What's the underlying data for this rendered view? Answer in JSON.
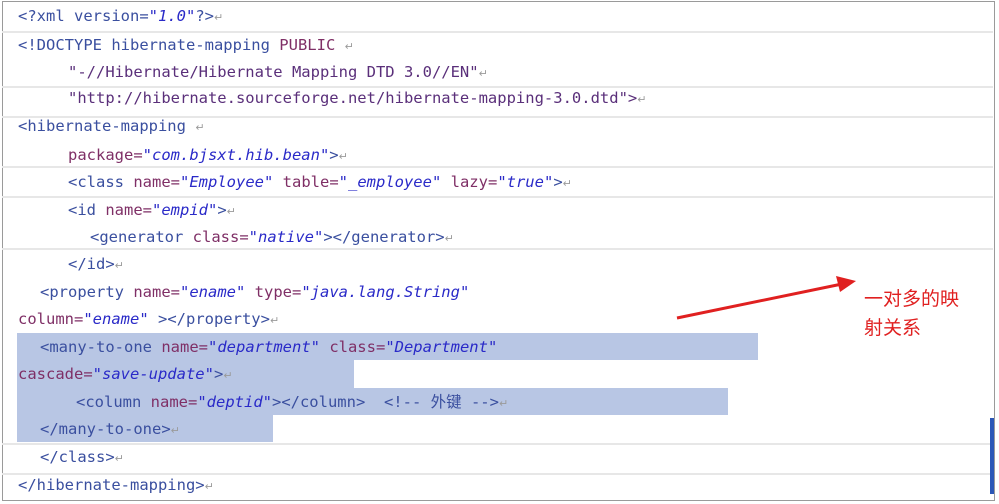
{
  "code": {
    "l1_open": "<?xml version=",
    "l1_val": "\"1.0\"",
    "l1_close": "?>",
    "l2_tag": "<!DOCTYPE hibernate-mapping",
    "l2_public": " PUBLIC ",
    "l3": "\"-//Hibernate/Hibernate Mapping DTD 3.0//EN\"",
    "l4": "\"http://hibernate.sourceforge.net/hibernate-mapping-3.0.dtd\">",
    "l5": "<hibernate-mapping ",
    "l6_attr": "package=",
    "l6_val": "\"com.bjsxt.hib.bean\"",
    "l6_close": ">",
    "l7_tag": "<class ",
    "l7_a1": "name=",
    "l7_v1": "\"Employee\"",
    "l7_a2": " table=",
    "l7_v2": "\"_employee\"",
    "l7_a3": " lazy=",
    "l7_v3": "\"true\"",
    "l7_close": ">",
    "l8_tag": "<id ",
    "l8_attr": "name=",
    "l8_val": "\"empid\"",
    "l8_close": ">",
    "l9_tag": "<generator ",
    "l9_attr": "class=",
    "l9_val": "\"native\"",
    "l9_close": "></generator>",
    "l10": "</id>",
    "l11_tag": "<property ",
    "l11_a1": "name=",
    "l11_v1": "\"ename\"",
    "l11_a2": " type=",
    "l11_v2": "\"java.lang.String\"",
    "l12_attr": "column=",
    "l12_val": "\"ename\"",
    "l12_close": " ></property>",
    "l13_tag": "<many-to-one ",
    "l13_a1": "name=",
    "l13_v1": "\"department\"",
    "l13_a2": " class=",
    "l13_v2": "\"Department\"",
    "l14_attr": "cascade=",
    "l14_val": "\"save-update\"",
    "l14_close": ">",
    "l15_tag": "<column ",
    "l15_attr": "name=",
    "l15_val": "\"deptid\"",
    "l15_close": "></column>",
    "l15_comment": "  <!-- 外键 -->",
    "l16": "</many-to-one>",
    "l17": "</class>",
    "l18": "</hibernate-mapping>",
    "return_mark": "↵"
  },
  "annotation": {
    "text_line1": "一对多的映",
    "text_line2": "射关系",
    "arrow_color": "#e02020"
  },
  "colors": {
    "highlight": "#b8c6e4",
    "tag": "#3a4f9f",
    "attribute": "#7f2f66",
    "value": "#2a2ac8",
    "annotation": "#e02020"
  }
}
